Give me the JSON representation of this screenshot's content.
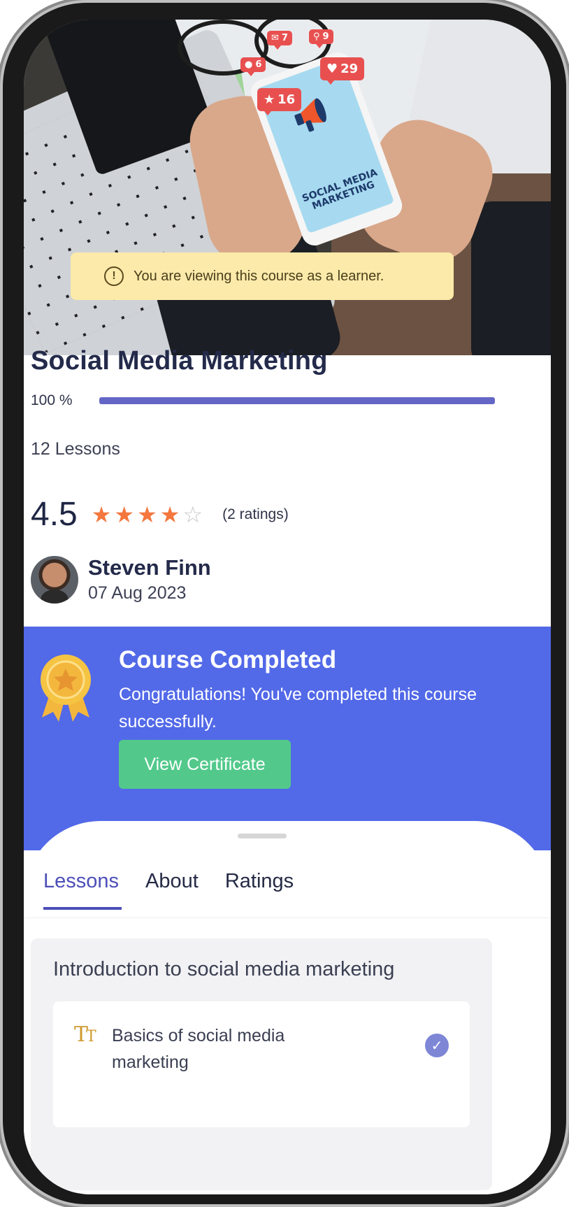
{
  "hero": {
    "phone_text": "SOCIAL MEDIA MARKETING",
    "notifications": [
      {
        "icon": "user-icon",
        "count": "6"
      },
      {
        "icon": "mail-icon",
        "count": "7"
      },
      {
        "icon": "pin-icon",
        "count": "9"
      },
      {
        "icon": "heart-icon",
        "count": "29"
      },
      {
        "icon": "star-icon",
        "count": "16"
      }
    ]
  },
  "banner": {
    "icon": "info-icon",
    "text": "You are viewing this course as a learner."
  },
  "course": {
    "title": "Social Media Marketing",
    "progress_label": "100 %",
    "progress_fraction": 1.0,
    "lessons_label": "12 Lessons",
    "rating_value": "4.5",
    "rating_stars_filled": 4,
    "rating_stars_total": 5,
    "rating_count": "(2 ratings)"
  },
  "author": {
    "name": "Steven Finn",
    "date": "07 Aug 2023"
  },
  "completed": {
    "icon": "award-ribbon-icon",
    "title": "Course Completed",
    "message": "Congratulations! You've completed this course successfully.",
    "button_label": "View Certificate"
  },
  "tabs": [
    {
      "label": "Lessons",
      "active": true
    },
    {
      "label": "About",
      "active": false
    },
    {
      "label": "Ratings",
      "active": false
    }
  ],
  "section": {
    "title": "Introduction to social media marketing",
    "lessons": [
      {
        "type_icon": "text-type-icon",
        "title": "Basics of social media marketing",
        "completed": true
      }
    ]
  },
  "colors": {
    "accent": "#4c4fb8",
    "completed_bg": "#5269e8",
    "certificate_button": "#52c98b",
    "banner_bg": "#fbeaa9",
    "star": "#f4773e"
  }
}
